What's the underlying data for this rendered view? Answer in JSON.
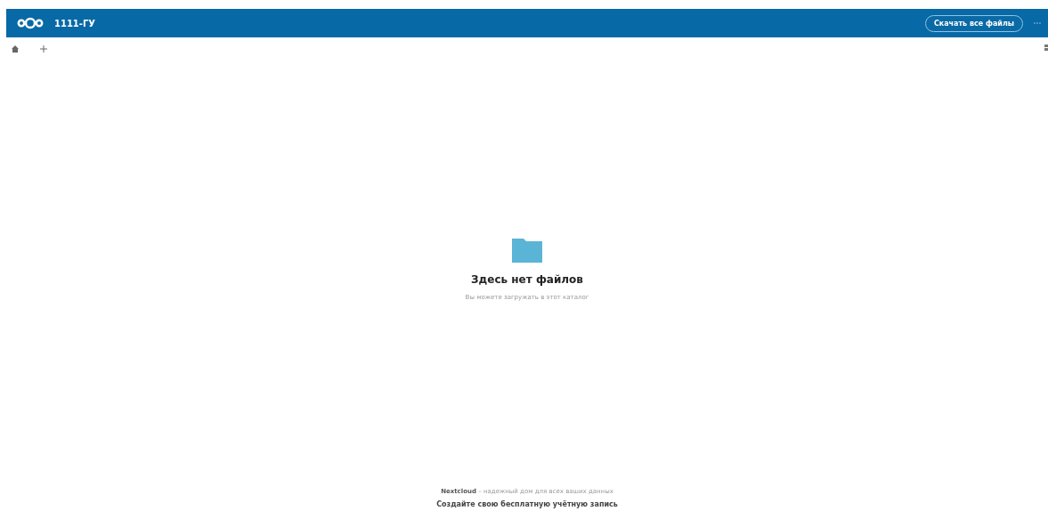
{
  "header": {
    "title": "1111-ГУ",
    "download_button": "Скачать все файлы"
  },
  "empty_state": {
    "heading": "Здесь нет файлов",
    "hint": "Вы можете загружать в этот каталог"
  },
  "footer": {
    "text": "**Nextcloud** – надежный дом для всех ваших данных",
    "link": "Создайте свою бесплатную учётную запись"
  }
}
